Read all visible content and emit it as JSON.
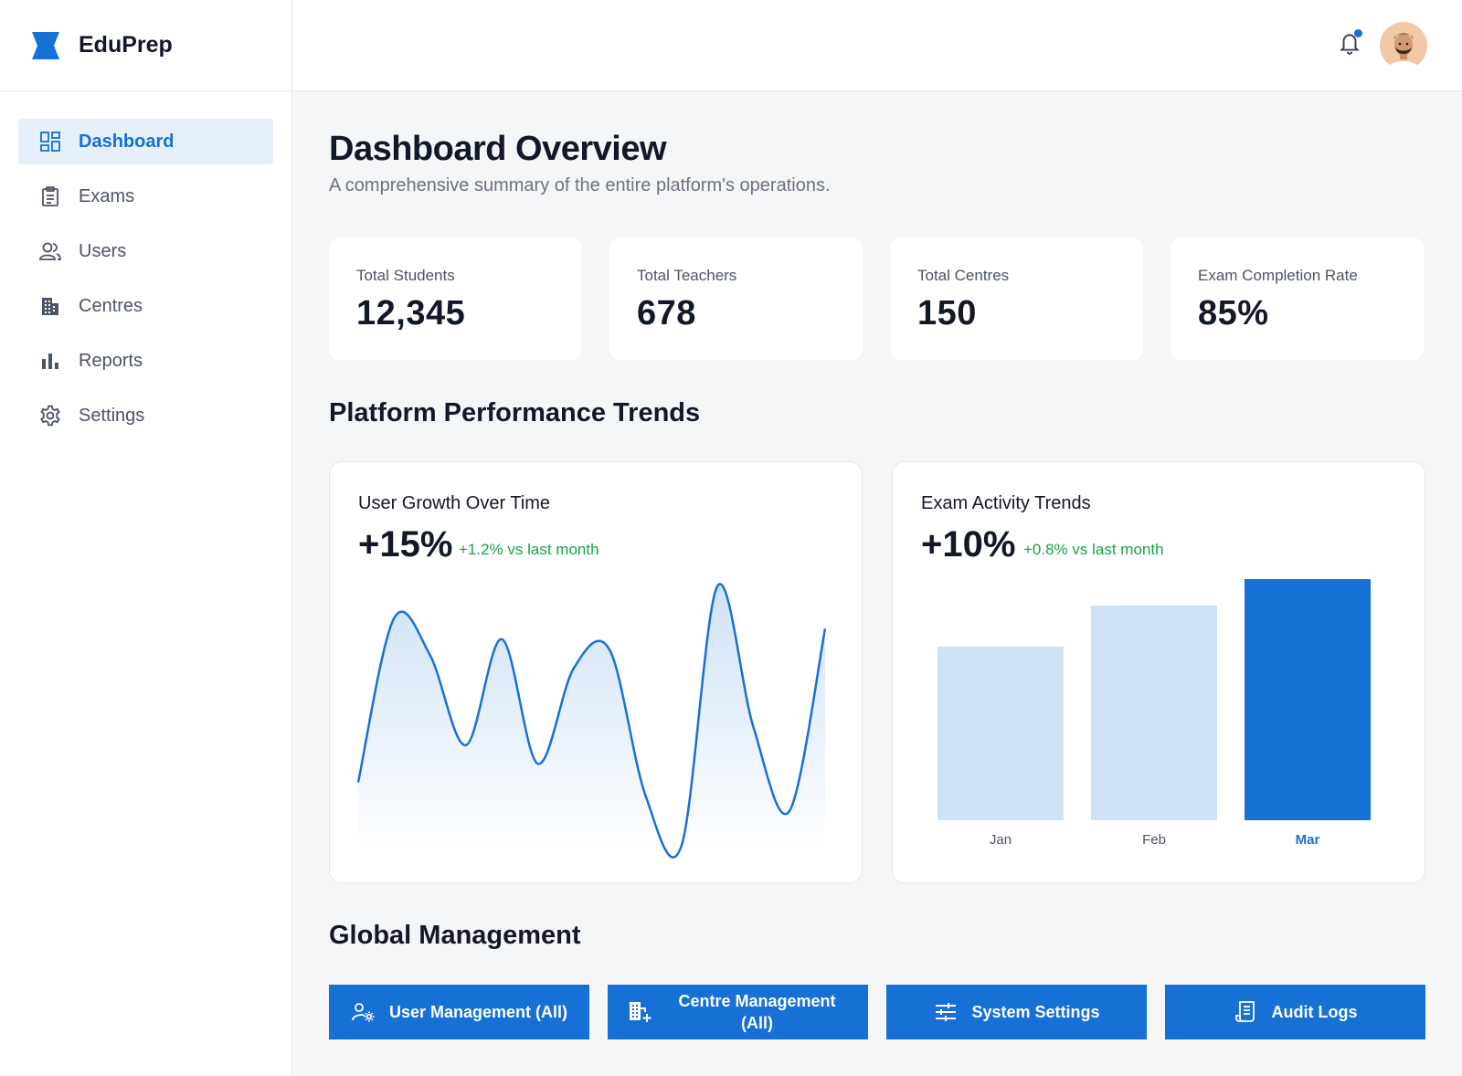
{
  "brand": {
    "name": "EduPrep",
    "accent_color": "#1670d6"
  },
  "sidebar": {
    "items": [
      {
        "label": "Dashboard",
        "icon": "dashboard-icon",
        "active": true
      },
      {
        "label": "Exams",
        "icon": "clipboard-icon",
        "active": false
      },
      {
        "label": "Users",
        "icon": "users-icon",
        "active": false
      },
      {
        "label": "Centres",
        "icon": "building-icon",
        "active": false
      },
      {
        "label": "Reports",
        "icon": "bar-chart-icon",
        "active": false
      },
      {
        "label": "Settings",
        "icon": "gear-icon",
        "active": false
      }
    ]
  },
  "topbar": {
    "notification_icon": "bell-icon",
    "has_unread": true,
    "avatar_icon": "user-avatar"
  },
  "page": {
    "title": "Dashboard Overview",
    "subtitle": "A comprehensive summary of the entire platform's operations."
  },
  "stats": [
    {
      "label": "Total Students",
      "value": "12,345"
    },
    {
      "label": "Total Teachers",
      "value": "678"
    },
    {
      "label": "Total Centres",
      "value": "150"
    },
    {
      "label": "Exam Completion Rate",
      "value": "85%"
    }
  ],
  "trends": {
    "title": "Platform Performance Trends"
  },
  "chart_data": [
    {
      "type": "area",
      "title": "User Growth Over Time",
      "headline": "+15%",
      "change": "+1.2% vs last month",
      "change_color": "#16a34a",
      "line_color": "#1670d6",
      "values": [
        24,
        86,
        72,
        38,
        78,
        31,
        67,
        74,
        19,
        0,
        98,
        45,
        13,
        82
      ],
      "ylim": [
        0,
        100
      ]
    },
    {
      "type": "bar",
      "title": "Exam Activity Trends",
      "headline": "+10%",
      "change": "+0.8% vs last month",
      "change_color": "#16a34a",
      "categories": [
        "Jan",
        "Feb",
        "Mar"
      ],
      "values": [
        72,
        89,
        100
      ],
      "ylim": [
        0,
        100
      ],
      "highlight_index": 2,
      "bar_color": "#cfe2f5",
      "highlight_color": "#1670d6"
    }
  ],
  "management": {
    "title": "Global Management",
    "buttons": [
      {
        "label": "User Management (All)",
        "icon": "user-gear-icon"
      },
      {
        "label": "Centre Management (All)",
        "icon": "building-add-icon"
      },
      {
        "label": "System Settings",
        "icon": "sliders-icon"
      },
      {
        "label": "Audit Logs",
        "icon": "receipt-icon"
      }
    ]
  }
}
